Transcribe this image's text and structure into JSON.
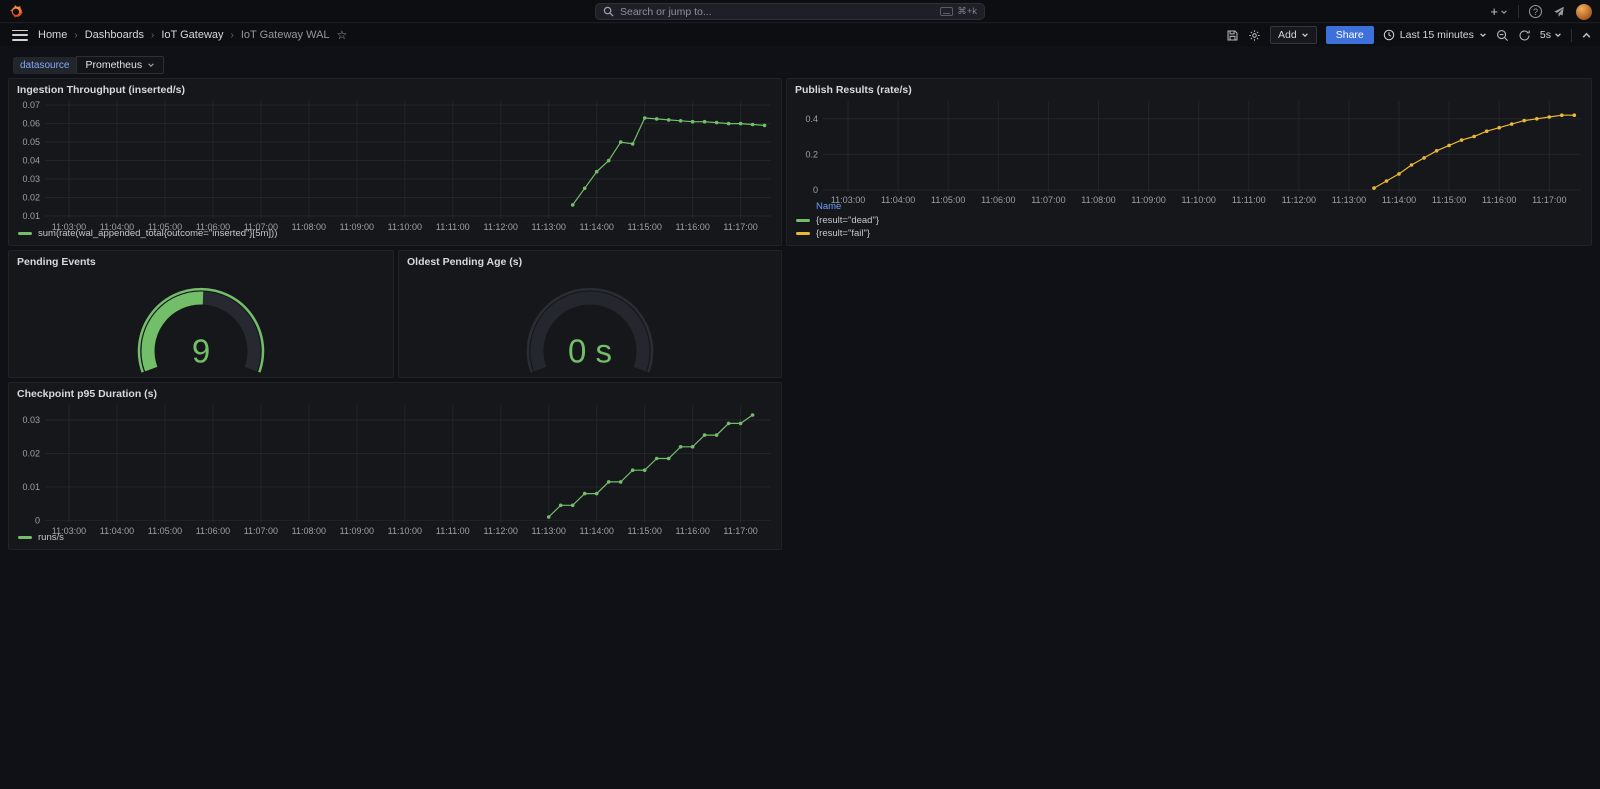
{
  "topbar": {
    "search_placeholder": "Search or jump to...",
    "search_shortcut": "⌘+k",
    "breadcrumb": {
      "separator": "›",
      "items": [
        "Home",
        "Dashboards",
        "IoT Gateway",
        "IoT Gateway WAL"
      ]
    },
    "toolbar": {
      "add": "Add",
      "share": "Share",
      "time_range": "Last 15 minutes",
      "interval": "5s"
    }
  },
  "variables": {
    "datasource_label": "datasource",
    "datasource_value": "Prometheus"
  },
  "colors": {
    "green": "#73bf69",
    "yellow": "#eab839",
    "accent_blue": "#3d71d9"
  },
  "chart_data": [
    {
      "type": "line",
      "title": "Ingestion Throughput (inserted/s)",
      "xlim": [
        150,
        1058
      ],
      "ylim": [
        0.0084,
        0.0722
      ],
      "x_tick_start": 180,
      "x_tick_step": 60,
      "x_tick_labels": [
        "11:03:00",
        "11:04:00",
        "11:05:00",
        "11:06:00",
        "11:07:00",
        "11:08:00",
        "11:09:00",
        "11:10:00",
        "11:11:00",
        "11:12:00",
        "11:13:00",
        "11:14:00",
        "11:15:00",
        "11:16:00",
        "11:17:00"
      ],
      "y_tick_vals": [
        0.01,
        0.02,
        0.03,
        0.04,
        0.05,
        0.06,
        0.07
      ],
      "y_tick_labels": [
        "0.01",
        "0.02",
        "0.03",
        "0.04",
        "0.05",
        "0.06",
        "0.07"
      ],
      "series": [
        {
          "name": "sum(rate(wal_appended_total{outcome=\"inserted\"}[5m]))",
          "color": "#73bf69",
          "x": [
            810,
            825,
            840,
            855,
            870,
            885,
            900,
            915,
            930,
            945,
            960,
            975,
            990,
            1005,
            1020,
            1035,
            1050
          ],
          "y": [
            0.016,
            0.025,
            0.034,
            0.04,
            0.05,
            0.049,
            0.063,
            0.0625,
            0.062,
            0.0615,
            0.061,
            0.061,
            0.0605,
            0.06,
            0.06,
            0.0595,
            0.059
          ]
        }
      ],
      "legend": {
        "items": [
          {
            "color": "#73bf69",
            "label": "sum(rate(wal_appended_total{outcome=\"inserted\"}[5m]))"
          }
        ]
      }
    },
    {
      "type": "line",
      "title": "Publish Results (rate/s)",
      "xlim": [
        150,
        1058
      ],
      "ylim": [
        -0.012,
        0.5
      ],
      "x_tick_start": 180,
      "x_tick_step": 60,
      "x_tick_labels": [
        "11:03:00",
        "11:04:00",
        "11:05:00",
        "11:06:00",
        "11:07:00",
        "11:08:00",
        "11:09:00",
        "11:10:00",
        "11:11:00",
        "11:12:00",
        "11:13:00",
        "11:14:00",
        "11:15:00",
        "11:16:00",
        "11:17:00"
      ],
      "y_tick_vals": [
        0,
        0.2,
        0.4
      ],
      "y_tick_labels": [
        "0",
        "0.2",
        "0.4"
      ],
      "series": [
        {
          "name": "{result=\"dead\"}",
          "color": "#73bf69",
          "x": [],
          "y": []
        },
        {
          "name": "{result=\"fail\"}",
          "color": "#eab839",
          "x": [
            810,
            825,
            840,
            855,
            870,
            885,
            900,
            915,
            930,
            945,
            960,
            975,
            990,
            1005,
            1020,
            1035,
            1050
          ],
          "y": [
            0.01,
            0.05,
            0.09,
            0.14,
            0.18,
            0.22,
            0.25,
            0.28,
            0.3,
            0.33,
            0.35,
            0.37,
            0.39,
            0.4,
            0.41,
            0.42,
            0.42
          ]
        }
      ],
      "legend": {
        "header": "Name",
        "items": [
          {
            "color": "#73bf69",
            "label": "{result=\"dead\"}"
          },
          {
            "color": "#eab839",
            "label": "{result=\"fail\"}"
          }
        ]
      }
    },
    {
      "type": "gauge",
      "title": "Pending Events",
      "value": 9,
      "value_text": "9",
      "percent": 51,
      "color": "#73bf69",
      "ring_color": "#73bf69",
      "track_color": "#262930"
    },
    {
      "type": "gauge",
      "title": "Oldest Pending Age (s)",
      "value": 0,
      "value_text": "0 s",
      "percent": 0,
      "color": "#73bf69",
      "ring_color": "#2a2d33",
      "track_color": "#24272d"
    },
    {
      "type": "line",
      "title": "Checkpoint p95 Duration (s)",
      "xlim": [
        150,
        1058
      ],
      "ylim": [
        -0.0008,
        0.0345
      ],
      "x_tick_start": 180,
      "x_tick_step": 60,
      "x_tick_labels": [
        "11:03:00",
        "11:04:00",
        "11:05:00",
        "11:06:00",
        "11:07:00",
        "11:08:00",
        "11:09:00",
        "11:10:00",
        "11:11:00",
        "11:12:00",
        "11:13:00",
        "11:14:00",
        "11:15:00",
        "11:16:00",
        "11:17:00"
      ],
      "y_tick_vals": [
        0,
        0.01,
        0.02,
        0.03
      ],
      "y_tick_labels": [
        "0",
        "0.01",
        "0.02",
        "0.03"
      ],
      "series": [
        {
          "name": "runs/s",
          "color": "#73bf69",
          "x": [
            780,
            795,
            810,
            825,
            840,
            855,
            870,
            885,
            900,
            915,
            930,
            945,
            960,
            975,
            990,
            1005,
            1020,
            1035
          ],
          "y": [
            0.001,
            0.0045,
            0.0045,
            0.008,
            0.008,
            0.0115,
            0.0115,
            0.015,
            0.015,
            0.0185,
            0.0185,
            0.022,
            0.022,
            0.0255,
            0.0255,
            0.029,
            0.029,
            0.0315
          ]
        }
      ],
      "legend": {
        "items": [
          {
            "color": "#73bf69",
            "label": "runs/s"
          }
        ]
      }
    }
  ]
}
